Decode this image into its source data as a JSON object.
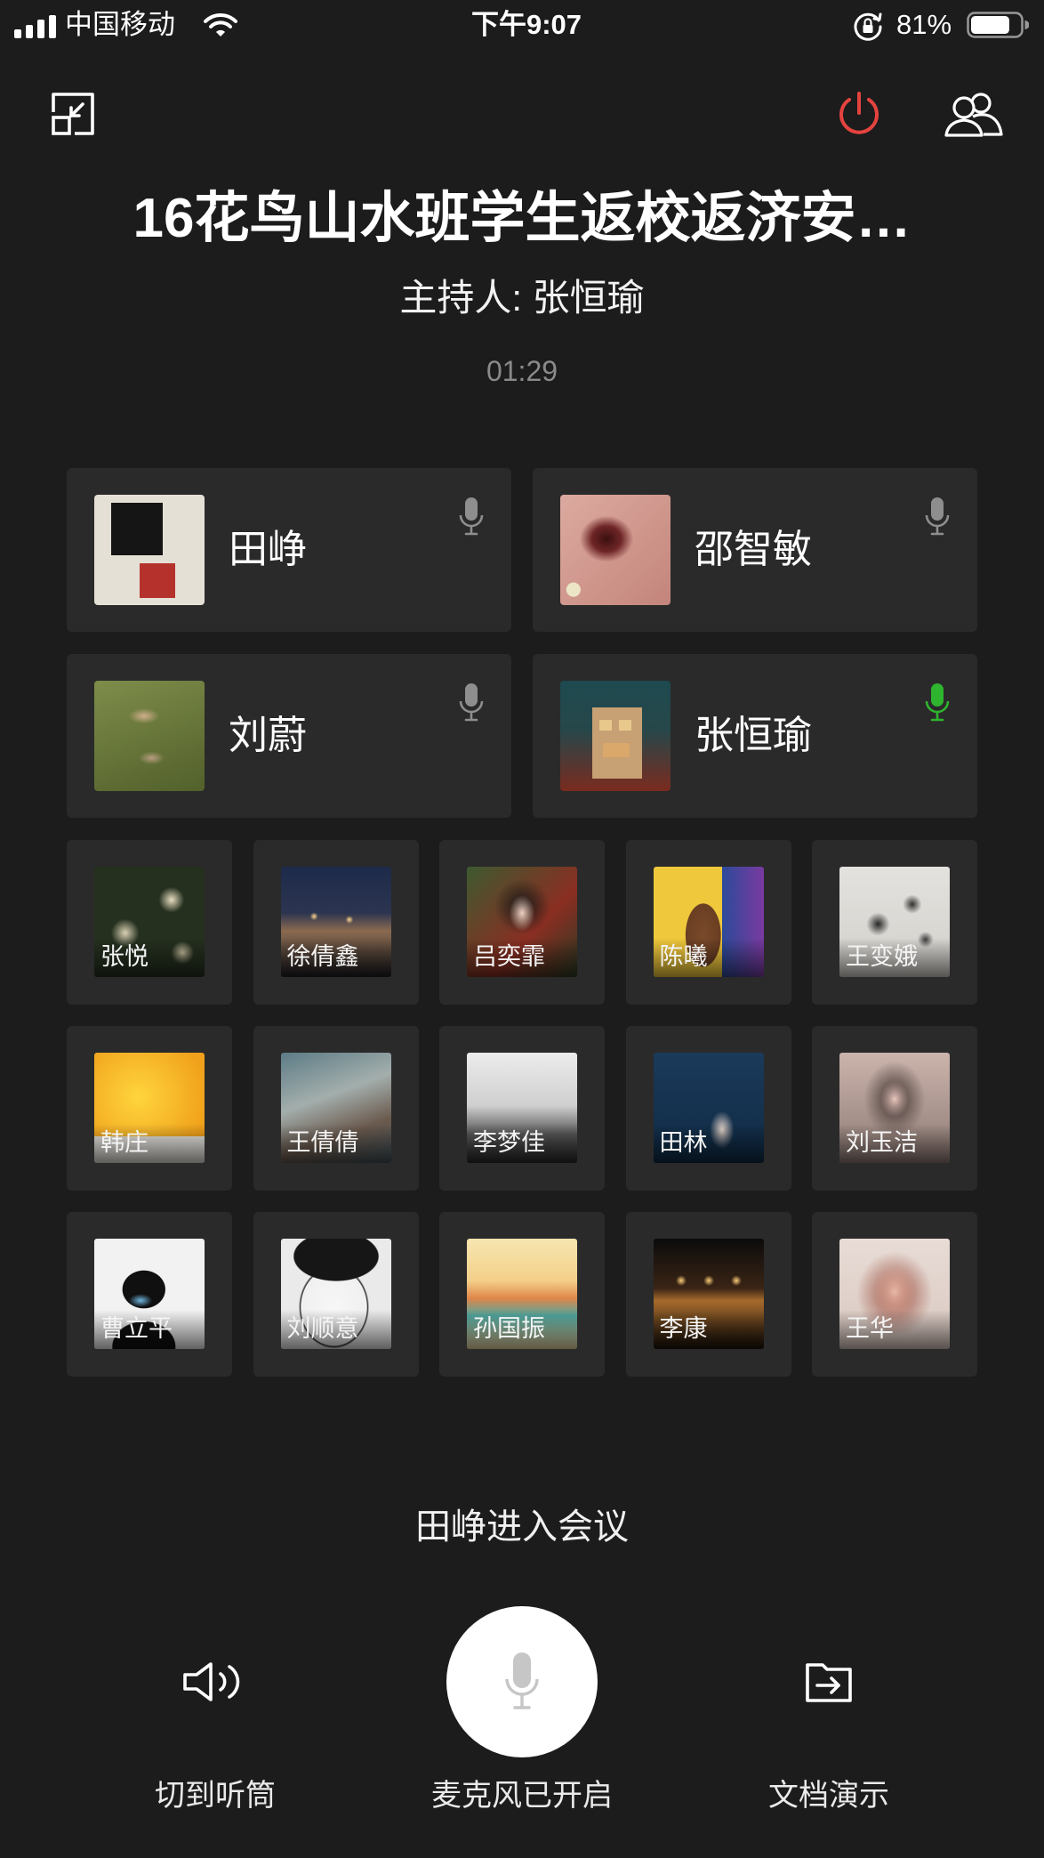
{
  "status_bar": {
    "carrier": "中国移动",
    "time": "下午9:07",
    "battery": "81%",
    "battery_level": 0.81,
    "icons": [
      "cellular-signal-icon",
      "wifi-icon",
      "rotation-lock-icon",
      "battery-icon"
    ]
  },
  "toolbar": {
    "icons": [
      "minimize-window-icon",
      "power-icon",
      "participants-icon"
    ]
  },
  "meeting": {
    "title": "16花鸟山水班学生返校返济安…",
    "host": "主持人: 张恒瑜",
    "duration": "01:29"
  },
  "participants": {
    "featured": [
      {
        "name": "田峥",
        "speaking": false
      },
      {
        "name": "邵智敏",
        "speaking": false
      },
      {
        "name": "刘蔚",
        "speaking": false
      },
      {
        "name": "张恒瑜",
        "speaking": true
      }
    ],
    "others": [
      {
        "name": "张悦"
      },
      {
        "name": "徐倩鑫"
      },
      {
        "name": "吕奕霏"
      },
      {
        "name": "陈曦"
      },
      {
        "name": "王变娥"
      },
      {
        "name": "韩庄"
      },
      {
        "name": "王倩倩"
      },
      {
        "name": "李梦佳"
      },
      {
        "name": "田林"
      },
      {
        "name": "刘玉洁"
      },
      {
        "name": "曹立平"
      },
      {
        "name": "刘顺意"
      },
      {
        "name": "孙国振"
      },
      {
        "name": "李康"
      },
      {
        "name": "王华"
      }
    ]
  },
  "notice": "田峥进入会议",
  "controls": {
    "speaker": {
      "label": "切到听筒",
      "icon": "speaker-icon"
    },
    "microphone": {
      "label": "麦克风已开启",
      "icon": "microphone-icon"
    },
    "document": {
      "label": "文档演示",
      "icon": "document-share-icon"
    }
  },
  "colors": {
    "background": "#1c1c1c",
    "card": "#2a2a2a",
    "mic_idle": "#8e8e8e",
    "mic_speaking": "#2fb42f",
    "leave": "#e5433f",
    "timer": "#8a8a8a"
  }
}
